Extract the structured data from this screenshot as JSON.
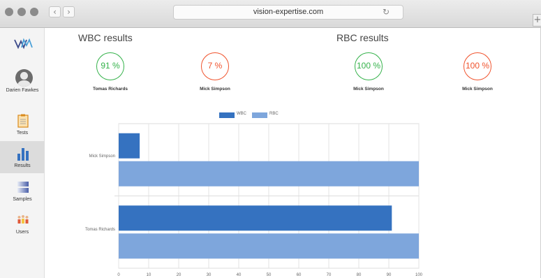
{
  "browser": {
    "url": "vision-expertise.com",
    "back_icon": "chevron-left-icon",
    "forward_icon": "chevron-right-icon",
    "reload_icon": "reload-icon",
    "new_tab_label": "+"
  },
  "sidebar": {
    "logo": "WM",
    "user_name": "Darien Fawkes",
    "items": [
      {
        "label": "Tests",
        "icon": "clipboard-icon",
        "active": false
      },
      {
        "label": "Results",
        "icon": "bar-chart-icon",
        "active": true
      },
      {
        "label": "Samples",
        "icon": "samples-icon",
        "active": false
      },
      {
        "label": "Users",
        "icon": "users-icon",
        "active": false
      }
    ]
  },
  "wbc": {
    "title": "WBC results",
    "cards": [
      {
        "value": "91 %",
        "name": "Tomas Richards",
        "color": "#34b24a"
      },
      {
        "value": "7 %",
        "name": "Mick Simpson",
        "color": "#f0522c"
      }
    ]
  },
  "rbc": {
    "title": "RBC results",
    "cards": [
      {
        "value": "100 %",
        "name": "Mick Simpson",
        "color": "#34b24a"
      },
      {
        "value": "100 %",
        "name": "Mick Simpson",
        "color": "#f0522c"
      }
    ]
  },
  "chart_data": {
    "type": "bar",
    "orientation": "horizontal",
    "categories": [
      "Mick Simpson",
      "Tomas Richards"
    ],
    "series": [
      {
        "name": "WBC",
        "values": [
          7,
          91
        ],
        "color": "#3572c0"
      },
      {
        "name": "RBC",
        "values": [
          100,
          100
        ],
        "color": "#7ea6dc"
      }
    ],
    "xlim": [
      0,
      100
    ],
    "xticks": [
      0,
      10,
      20,
      30,
      40,
      50,
      60,
      70,
      80,
      90,
      100
    ],
    "grid": true,
    "legend": "top"
  }
}
